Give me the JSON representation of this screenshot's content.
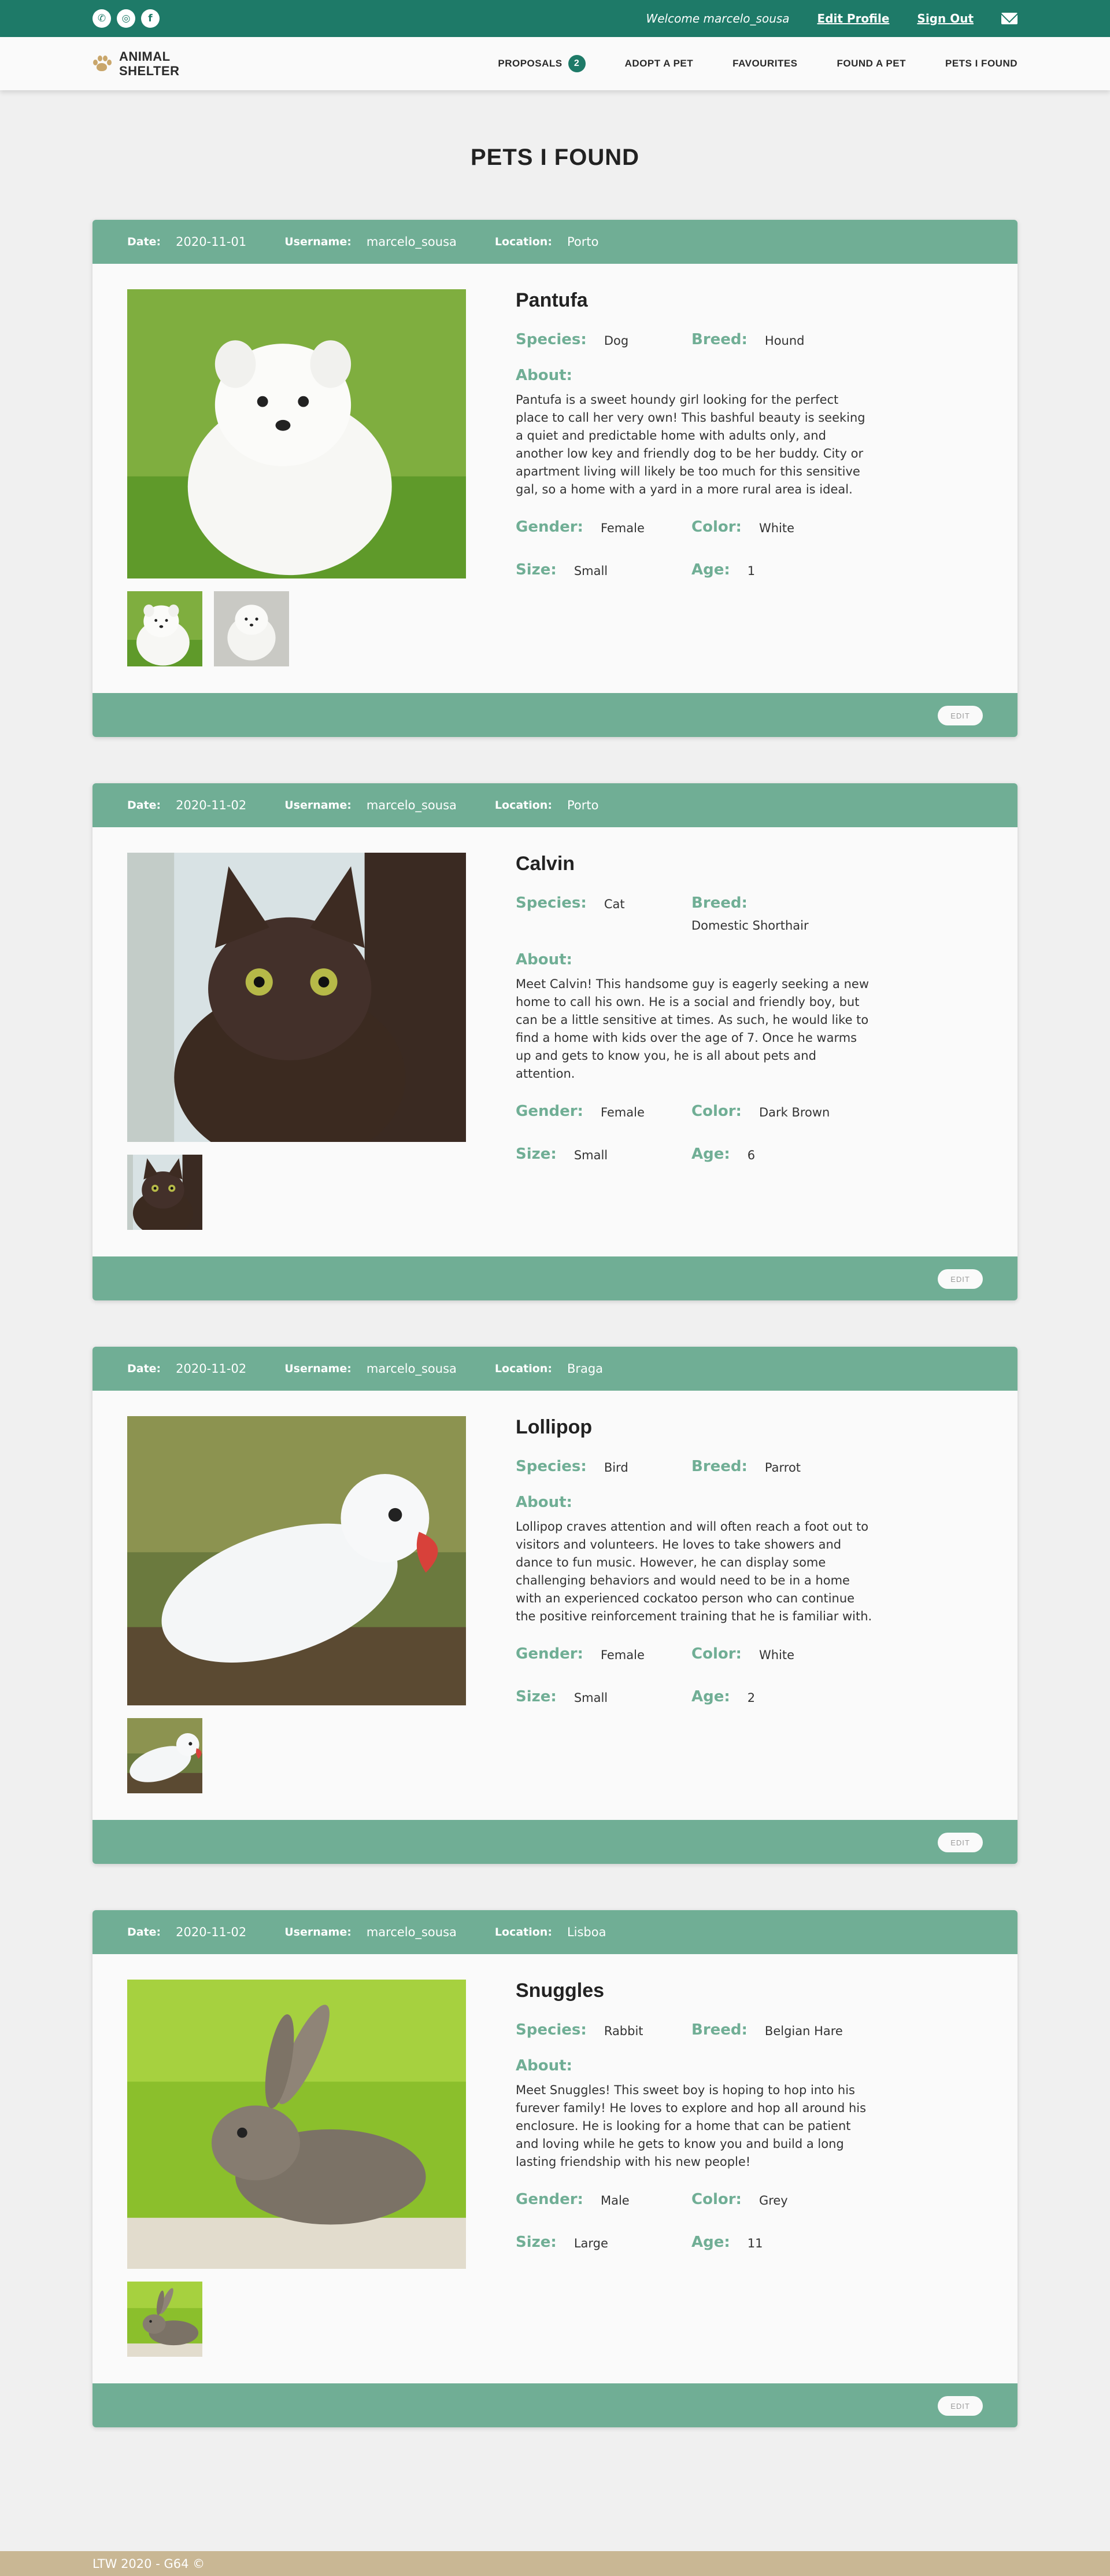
{
  "topbar": {
    "social": [
      "whatsapp-icon",
      "instagram-icon",
      "facebook-icon"
    ],
    "welcome": "Welcome marcelo_sousa",
    "edit_profile": "Edit Profile",
    "sign_out": "Sign Out",
    "mail_icon": "mail-icon"
  },
  "navbar": {
    "logo_line1": "ANIMAL",
    "logo_line2": "SHELTER",
    "items": {
      "proposals": "PROPOSALS",
      "proposals_count": "2",
      "adopt": "ADOPT A PET",
      "favourites": "FAVOURITES",
      "found": "FOUND A PET",
      "pets_found": "PETS I FOUND"
    }
  },
  "page": {
    "title": "PETS I FOUND"
  },
  "labels": {
    "date": "Date:",
    "username": "Username:",
    "location": "Location:",
    "species": "Species:",
    "breed": "Breed:",
    "about": "About:",
    "gender": "Gender:",
    "color": "Color:",
    "size": "Size:",
    "age": "Age:",
    "edit": "EDIT"
  },
  "pets": [
    {
      "date": "2020-11-01",
      "username": "marcelo_sousa",
      "location": "Porto",
      "name": "Pantufa",
      "species": "Dog",
      "breed": "Hound",
      "about": "Pantufa is a sweet houndy girl looking for the perfect place to call her very own! This bashful beauty is seeking a quiet and predictable home with adults only, and another low key and friendly dog to be her buddy. City or apartment living will likely be too much for this sensitive gal, so a home with a yard in a more rural area is ideal.",
      "gender": "Female",
      "color": "White",
      "size": "Small",
      "age": "1",
      "photo_count": 2
    },
    {
      "date": "2020-11-02",
      "username": "marcelo_sousa",
      "location": "Porto",
      "name": "Calvin",
      "species": "Cat",
      "breed": "Domestic Shorthair",
      "about": "Meet Calvin! This handsome guy is eagerly seeking a new home to call his own. He is a social and friendly boy, but can be a little sensitive at times. As such, he would like to find a home with kids over the age of 7. Once he warms up and gets to know you, he is all about pets and attention.",
      "gender": "Female",
      "color": "Dark Brown",
      "size": "Small",
      "age": "6",
      "photo_count": 1
    },
    {
      "date": "2020-11-02",
      "username": "marcelo_sousa",
      "location": "Braga",
      "name": "Lollipop",
      "species": "Bird",
      "breed": "Parrot",
      "about": "Lollipop craves attention and will often reach a foot out to visitors and volunteers. He loves to take showers and dance to fun music. However, he can display some challenging behaviors and would need to be in a home with an experienced cockatoo person who can continue the positive reinforcement training that he is familiar with.",
      "gender": "Female",
      "color": "White",
      "size": "Small",
      "age": "2",
      "photo_count": 1
    },
    {
      "date": "2020-11-02",
      "username": "marcelo_sousa",
      "location": "Lisboa",
      "name": "Snuggles",
      "species": "Rabbit",
      "breed": "Belgian Hare",
      "about": "Meet Snuggles! This sweet boy is hoping to hop into his furever family! He loves to explore and hop all around his enclosure. He is looking for a home that can be patient and loving while he gets to know you and build a long lasting friendship with his new people!",
      "gender": "Male",
      "color": "Grey",
      "size": "Large",
      "age": "11",
      "photo_count": 1
    }
  ],
  "footer": {
    "text": "LTW 2020 - G64 ©"
  }
}
